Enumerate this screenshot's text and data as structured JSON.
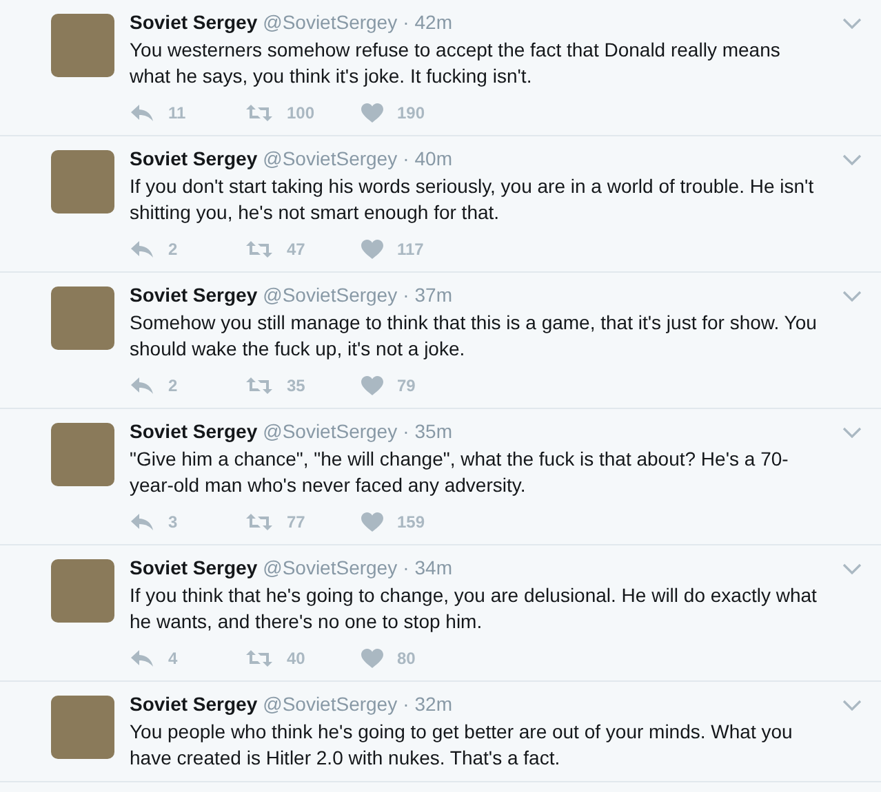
{
  "separator": "·",
  "tweets": [
    {
      "name": "Soviet Sergey",
      "handle": "@SovietSergey",
      "time": "42m",
      "text": "You westerners somehow refuse to accept the fact that Donald really means what he says, you think it's joke. It fucking isn't.",
      "replies": "11",
      "retweets": "100",
      "likes": "190"
    },
    {
      "name": "Soviet Sergey",
      "handle": "@SovietSergey",
      "time": "40m",
      "text": "If you don't start taking his words seriously, you are in a world of trouble. He isn't shitting you, he's not smart enough for that.",
      "replies": "2",
      "retweets": "47",
      "likes": "117"
    },
    {
      "name": "Soviet Sergey",
      "handle": "@SovietSergey",
      "time": "37m",
      "text": "Somehow you still manage to think that this is a game, that it's just for show. You should wake the fuck up, it's not a joke.",
      "replies": "2",
      "retweets": "35",
      "likes": "79"
    },
    {
      "name": "Soviet Sergey",
      "handle": "@SovietSergey",
      "time": "35m",
      "text": "\"Give him a chance\", \"he will change\", what the fuck is that about? He's a 70-year-old man who's never faced any adversity.",
      "replies": "3",
      "retweets": "77",
      "likes": "159"
    },
    {
      "name": "Soviet Sergey",
      "handle": "@SovietSergey",
      "time": "34m",
      "text": "If you think that he's going to change, you are delusional. He will do exactly what he wants, and there's no one to stop him.",
      "replies": "4",
      "retweets": "40",
      "likes": "80"
    },
    {
      "name": "Soviet Sergey",
      "handle": "@SovietSergey",
      "time": "32m",
      "text": "You people who think he's going to get better are out of your minds. What you have created is Hitler 2.0 with nukes. That's a fact."
    }
  ]
}
